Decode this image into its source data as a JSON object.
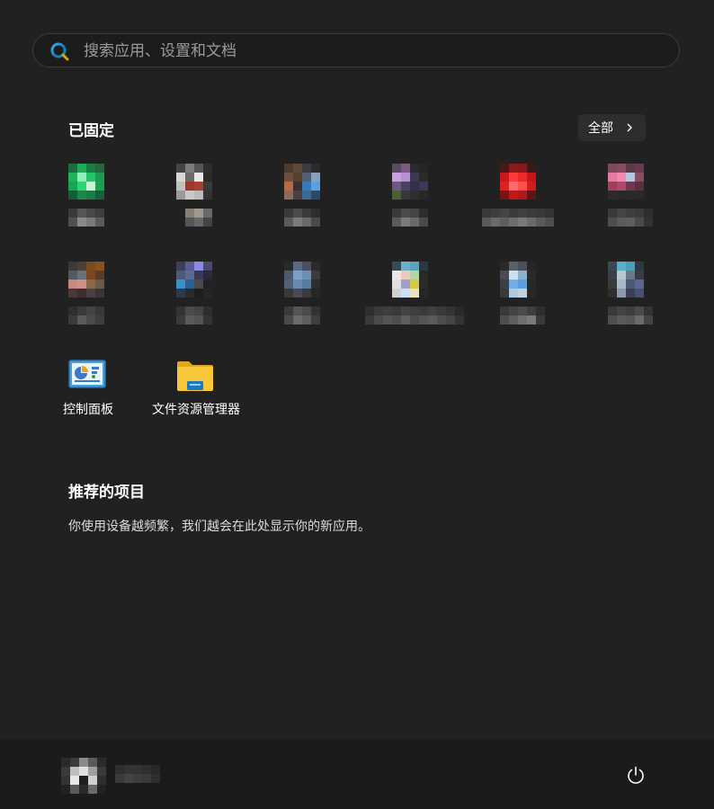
{
  "search": {
    "placeholder": "搜索应用、设置和文档"
  },
  "pinned": {
    "title": "已固定",
    "all_label": "全部",
    "apps": [
      {
        "label": "控制面板",
        "icon": "control-panel-icon"
      },
      {
        "label": "文件资源管理器",
        "icon": "folder-icon"
      }
    ]
  },
  "recommended": {
    "title": "推荐的项目",
    "text": "你使用设备越频繁，我们越会在此处显示你的新应用。"
  },
  "footer": {
    "power_icon": "power-icon"
  },
  "colors": {
    "background": "#212121",
    "footer": "#1b1b1b",
    "search_bg": "#1c1c1c",
    "button_bg": "#2d2d2d"
  }
}
